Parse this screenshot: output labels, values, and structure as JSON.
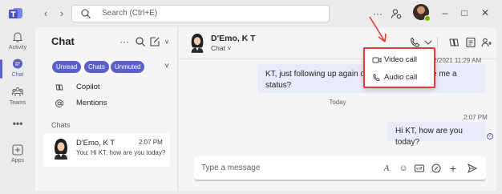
{
  "titlebar": {
    "search_placeholder": "Search (Ctrl+E)",
    "more_label": "···"
  },
  "rail": {
    "items": [
      {
        "label": "Activity",
        "icon": "bell-icon"
      },
      {
        "label": "Chat",
        "icon": "chat-icon"
      },
      {
        "label": "Teams",
        "icon": "teams-icon"
      },
      {
        "label": "",
        "icon": "more-icon"
      },
      {
        "label": "Apps",
        "icon": "apps-icon"
      }
    ]
  },
  "chatlist": {
    "title": "Chat",
    "filters": [
      "Unread",
      "Chats",
      "Unmuted"
    ],
    "pinned": [
      {
        "label": "Copilot",
        "icon": "copilot-icon"
      },
      {
        "label": "Mentions",
        "icon": "at-icon"
      }
    ],
    "section": "Chats",
    "item": {
      "name": "D'Emo, K T",
      "time": "2:07 PM",
      "preview": "You: Hi KT, how are you today?"
    }
  },
  "conversation": {
    "name": "D'Emo, K T",
    "subtitle": "Chat",
    "messages": [
      {
        "meta": "/2/2021 11:29 AM",
        "line1": "KT, just following up again on t",
        "line2": "status?",
        "tail": "e me a"
      },
      {
        "day": "Today"
      },
      {
        "meta": "2:07 PM",
        "text": "Hi KT, how are you today?"
      }
    ],
    "composer_placeholder": "Type a message"
  },
  "call_menu": {
    "items": [
      {
        "label": "Video call",
        "icon": "video-icon"
      },
      {
        "label": "Audio call",
        "icon": "phone-icon"
      }
    ]
  },
  "colors": {
    "brand": "#5b5fc7",
    "bubble": "#e8ebfa",
    "annotation": "#e03b3b",
    "presence": "#6bb700"
  }
}
